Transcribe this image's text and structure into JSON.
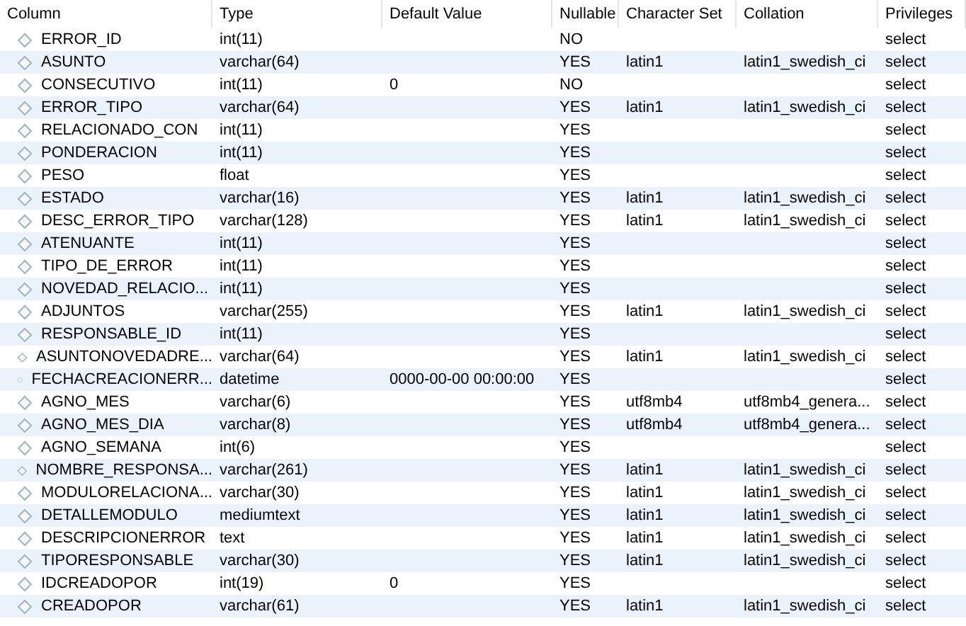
{
  "table": {
    "columns": [
      "Column",
      "Type",
      "Default Value",
      "Nullable",
      "Character Set",
      "Collation",
      "Privileges"
    ],
    "rows": [
      {
        "name": "ERROR_ID",
        "type": "int(11)",
        "nullable": "NO",
        "privileges": "select"
      },
      {
        "name": "ASUNTO",
        "type": "varchar(64)",
        "nullable": "YES",
        "charset": "latin1",
        "collation": "latin1_swedish_ci",
        "privileges": "select"
      },
      {
        "name": "CONSECUTIVO",
        "type": "int(11)",
        "default": "0",
        "nullable": "NO",
        "privileges": "select"
      },
      {
        "name": "ERROR_TIPO",
        "type": "varchar(64)",
        "nullable": "YES",
        "charset": "latin1",
        "collation": "latin1_swedish_ci",
        "privileges": "select"
      },
      {
        "name": "RELACIONADO_CON",
        "type": "int(11)",
        "nullable": "YES",
        "privileges": "select"
      },
      {
        "name": "PONDERACION",
        "type": "int(11)",
        "nullable": "YES",
        "privileges": "select"
      },
      {
        "name": "PESO",
        "type": "float",
        "nullable": "YES",
        "privileges": "select"
      },
      {
        "name": "ESTADO",
        "type": "varchar(16)",
        "nullable": "YES",
        "charset": "latin1",
        "collation": "latin1_swedish_ci",
        "privileges": "select"
      },
      {
        "name": "DESC_ERROR_TIPO",
        "type": "varchar(128)",
        "nullable": "YES",
        "charset": "latin1",
        "collation": "latin1_swedish_ci",
        "privileges": "select"
      },
      {
        "name": "ATENUANTE",
        "type": "int(11)",
        "nullable": "YES",
        "privileges": "select"
      },
      {
        "name": "TIPO_DE_ERROR",
        "type": "int(11)",
        "nullable": "YES",
        "privileges": "select"
      },
      {
        "name": "NOVEDAD_RELACIO...",
        "type": "int(11)",
        "nullable": "YES",
        "privileges": "select"
      },
      {
        "name": "ADJUNTOS",
        "type": "varchar(255)",
        "nullable": "YES",
        "charset": "latin1",
        "collation": "latin1_swedish_ci",
        "privileges": "select"
      },
      {
        "name": "RESPONSABLE_ID",
        "type": "int(11)",
        "nullable": "YES",
        "privileges": "select"
      },
      {
        "name": "ASUNTONOVEDADRE...",
        "type": "varchar(64)",
        "nullable": "YES",
        "charset": "latin1",
        "collation": "latin1_swedish_ci",
        "privileges": "select"
      },
      {
        "name": "FECHACREACIONERR...",
        "type": "datetime",
        "default": "0000-00-00 00:00:00",
        "nullable": "YES",
        "privileges": "select"
      },
      {
        "name": "AGNO_MES",
        "type": "varchar(6)",
        "nullable": "YES",
        "charset": "utf8mb4",
        "collation": "utf8mb4_genera...",
        "privileges": "select"
      },
      {
        "name": "AGNO_MES_DIA",
        "type": "varchar(8)",
        "nullable": "YES",
        "charset": "utf8mb4",
        "collation": "utf8mb4_genera...",
        "privileges": "select"
      },
      {
        "name": "AGNO_SEMANA",
        "type": "int(6)",
        "nullable": "YES",
        "privileges": "select"
      },
      {
        "name": "NOMBRE_RESPONSA...",
        "type": "varchar(261)",
        "nullable": "YES",
        "charset": "latin1",
        "collation": "latin1_swedish_ci",
        "privileges": "select"
      },
      {
        "name": "MODULORELACIONA...",
        "type": "varchar(30)",
        "nullable": "YES",
        "charset": "latin1",
        "collation": "latin1_swedish_ci",
        "privileges": "select"
      },
      {
        "name": "DETALLEMODULO",
        "type": "mediumtext",
        "nullable": "YES",
        "charset": "latin1",
        "collation": "latin1_swedish_ci",
        "privileges": "select"
      },
      {
        "name": "DESCRIPCIONERROR",
        "type": "text",
        "nullable": "YES",
        "charset": "latin1",
        "collation": "latin1_swedish_ci",
        "privileges": "select"
      },
      {
        "name": "TIPORESPONSABLE",
        "type": "varchar(30)",
        "nullable": "YES",
        "charset": "latin1",
        "collation": "latin1_swedish_ci",
        "privileges": "select"
      },
      {
        "name": "IDCREADOPOR",
        "type": "int(19)",
        "default": "0",
        "nullable": "YES",
        "privileges": "select"
      },
      {
        "name": "CREADOPOR",
        "type": "varchar(61)",
        "nullable": "YES",
        "charset": "latin1",
        "collation": "latin1_swedish_ci",
        "privileges": "select"
      }
    ]
  }
}
